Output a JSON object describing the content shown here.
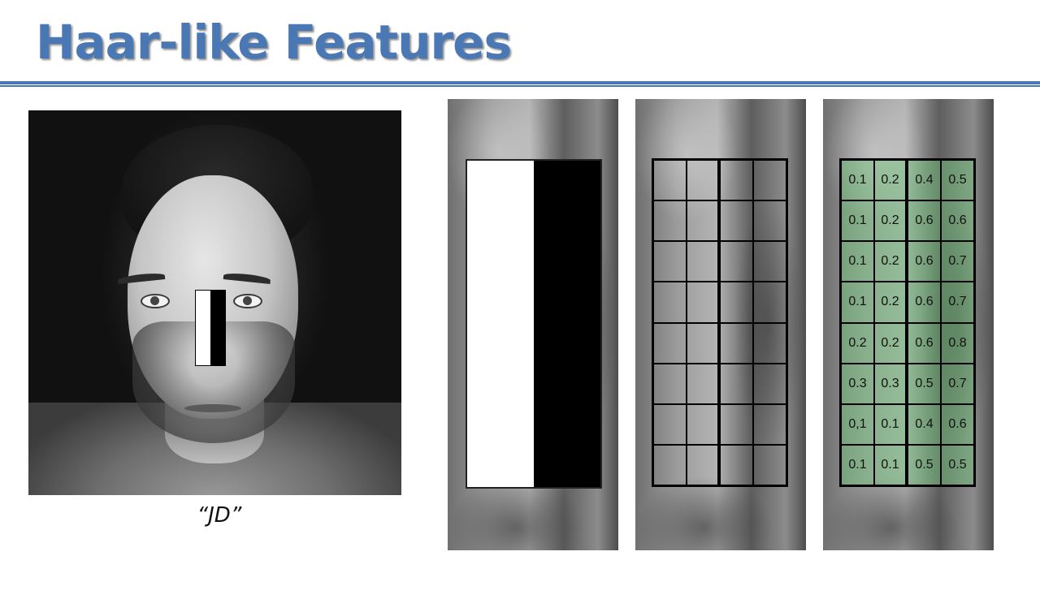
{
  "slide": {
    "title": "Haar-like Features",
    "caption": "“JD”",
    "accent_color": "#4a78b4",
    "overlay_color": "#7cc47f"
  },
  "pixel_grid": {
    "rows": [
      [
        "0.1",
        "0.2",
        "0.4",
        "0.5"
      ],
      [
        "0.1",
        "0.2",
        "0.6",
        "0.6"
      ],
      [
        "0.1",
        "0.2",
        "0.6",
        "0.7"
      ],
      [
        "0.1",
        "0.2",
        "0.6",
        "0.7"
      ],
      [
        "0.2",
        "0.2",
        "0.6",
        "0.8"
      ],
      [
        "0.3",
        "0.3",
        "0.5",
        "0.7"
      ],
      [
        "0,1",
        "0.1",
        "0.4",
        "0.6"
      ],
      [
        "0.1",
        "0.1",
        "0.5",
        "0.5"
      ]
    ]
  }
}
